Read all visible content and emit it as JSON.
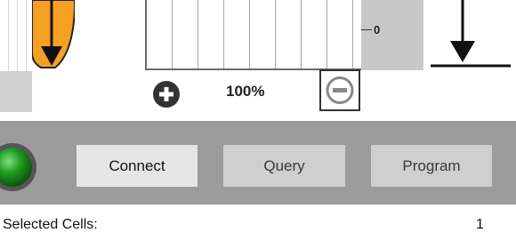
{
  "zoom": {
    "level": "100%",
    "in_icon": "plus-circle-icon",
    "out_icon": "minus-circle-icon"
  },
  "scale": {
    "zero_label": "0"
  },
  "toolbar": {
    "status_icon": "green-led-icon",
    "connect_label": "Connect",
    "query_label": "Query",
    "program_label": "Program"
  },
  "status_bar": {
    "selected_cells_label": "Selected Cells:",
    "selected_cells_value": "1"
  },
  "colors": {
    "accent_orange": "#F5A020",
    "toolbar_bg": "#9C9C9C",
    "led_green": "#1E8B1E"
  }
}
